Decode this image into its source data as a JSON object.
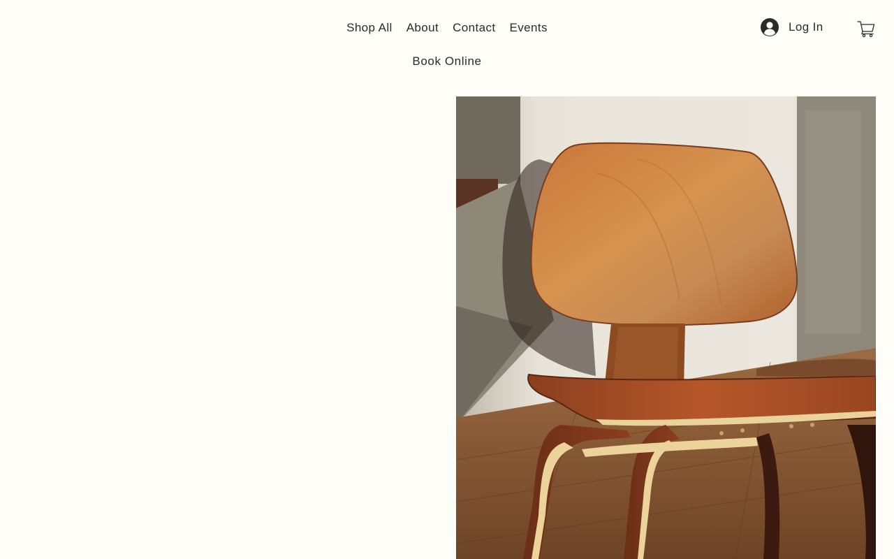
{
  "nav": {
    "items": [
      {
        "label": "Shop All"
      },
      {
        "label": "About"
      },
      {
        "label": "Contact"
      },
      {
        "label": "Events"
      }
    ],
    "second_row": [
      {
        "label": "Book Online"
      }
    ]
  },
  "account": {
    "login_label": "Log In",
    "avatar_icon": "user-avatar-icon"
  },
  "cart": {
    "icon": "shopping-cart-icon"
  },
  "hero": {
    "image_subject": "wooden lounge chair",
    "colors": {
      "wall": "#e8e3da",
      "wood_light": "#c9813e",
      "wood_dark": "#7a3b1f",
      "floor": "#8a5a35"
    }
  },
  "theme": {
    "background": "#fffdf7",
    "text": "#2b2b2b"
  }
}
